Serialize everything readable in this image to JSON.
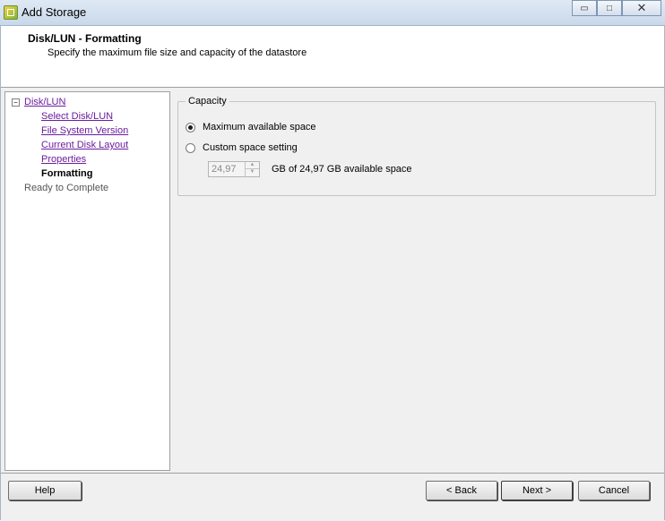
{
  "window": {
    "title": "Add Storage",
    "controls": {
      "minimize": "▭",
      "maximize": "□",
      "close": "✕"
    }
  },
  "header": {
    "title": "Disk/LUN - Formatting",
    "subtitle": "Specify the maximum file size and capacity of the datastore"
  },
  "steps": {
    "collapse_glyph": "−",
    "items": [
      {
        "label": "Disk/LUN",
        "state": "link"
      },
      {
        "label": "Select Disk/LUN",
        "state": "link"
      },
      {
        "label": "File System Version",
        "state": "link"
      },
      {
        "label": "Current Disk Layout",
        "state": "link"
      },
      {
        "label": "Properties",
        "state": "link"
      },
      {
        "label": "Formatting",
        "state": "current"
      },
      {
        "label": "Ready to Complete",
        "state": "pending"
      }
    ]
  },
  "capacity": {
    "legend": "Capacity",
    "option_max": {
      "label": "Maximum available space",
      "selected": true
    },
    "option_custom": {
      "label": "Custom space setting",
      "selected": false
    },
    "size_value": "24,97",
    "size_suffix": "GB of 24,97 GB available space",
    "spin_up": "▲",
    "spin_down": "▼"
  },
  "footer": {
    "help_label": "Help",
    "back_label": "< Back",
    "next_label": "Next >",
    "cancel_label": "Cancel"
  },
  "colors": {
    "link": "#6b1d9e",
    "dialog_bg": "#f0f0f0",
    "header_bg": "#ffffff"
  }
}
